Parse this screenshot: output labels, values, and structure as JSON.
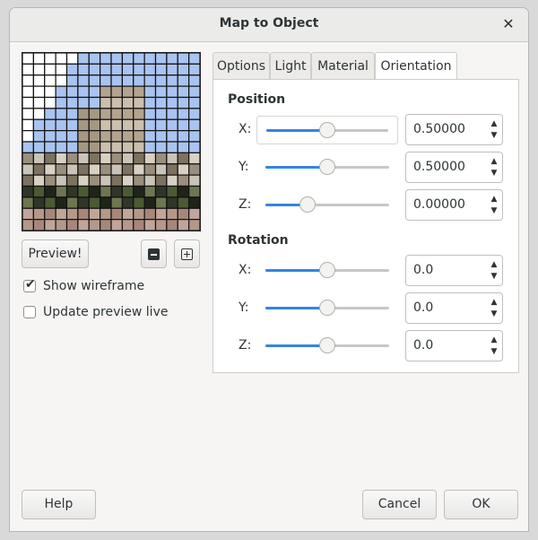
{
  "window": {
    "title": "Map to Object"
  },
  "controls": {
    "preview_label": "Preview!"
  },
  "options": {
    "show_wireframe": {
      "label": "Show wireframe",
      "checked": true
    },
    "update_preview_live": {
      "label": "Update preview live",
      "checked": false
    }
  },
  "tabs": [
    {
      "label": "Options",
      "active": false
    },
    {
      "label": "Light",
      "active": false
    },
    {
      "label": "Material",
      "active": false
    },
    {
      "label": "Orientation",
      "active": true
    }
  ],
  "position": {
    "title": "Position",
    "rows": [
      {
        "label": "X:",
        "value": "0.50000",
        "fraction": 0.5
      },
      {
        "label": "Y:",
        "value": "0.50000",
        "fraction": 0.5
      },
      {
        "label": "Z:",
        "value": "0.00000",
        "fraction": 0.34
      }
    ]
  },
  "rotation": {
    "title": "Rotation",
    "rows": [
      {
        "label": "X:",
        "value": "0.0",
        "fraction": 0.5
      },
      {
        "label": "Y:",
        "value": "0.0",
        "fraction": 0.5
      },
      {
        "label": "Z:",
        "value": "0.0",
        "fraction": 0.5
      }
    ]
  },
  "footer": {
    "help_label": "Help",
    "cancel_label": "Cancel",
    "ok_label": "OK"
  },
  "colors": {
    "accent": "#3584e4",
    "preview_sky": "#a9c4f0"
  }
}
